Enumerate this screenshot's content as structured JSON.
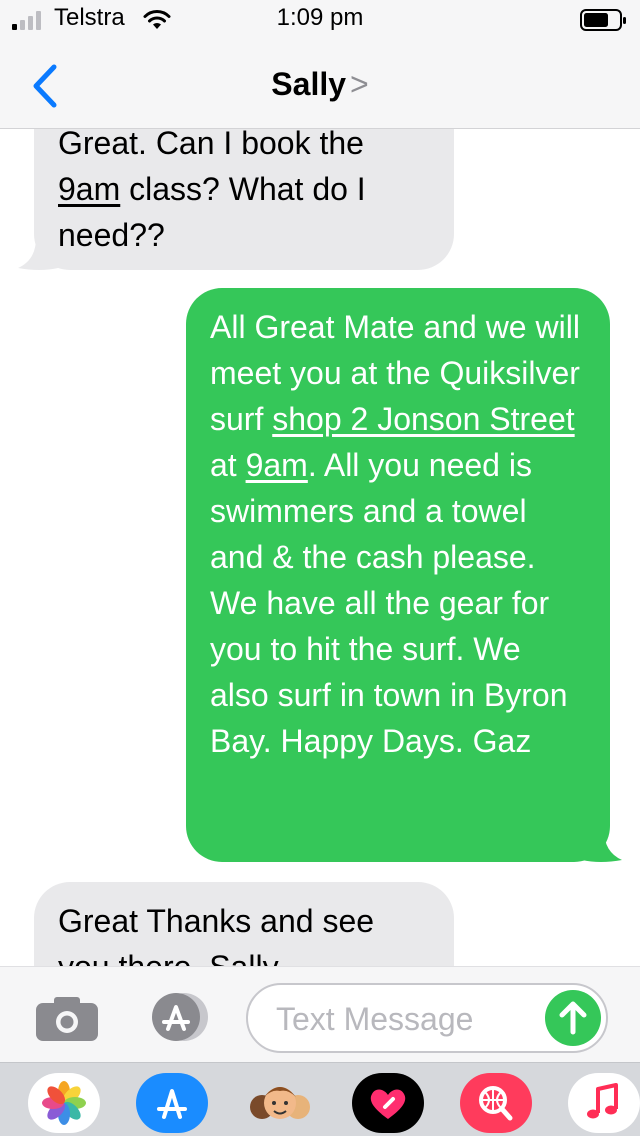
{
  "status": {
    "carrier": "Telstra",
    "time": "1:09 pm"
  },
  "nav": {
    "contact": "Sally",
    "chevron": ">"
  },
  "messages": [
    {
      "direction": "incoming",
      "parts": [
        "Great. Can I book the ",
        "9am",
        " class? What do I need??"
      ]
    },
    {
      "direction": "outgoing",
      "parts": [
        "All Great Mate and we will meet you at the Quiksilver surf ",
        "shop 2 Jonson Street",
        " at ",
        "9am",
        ". All you need is swimmers and a towel and & the cash please. We have all the gear for you to hit the surf. We also surf in town in Byron Bay. Happy Days. Gaz"
      ]
    },
    {
      "direction": "incoming",
      "parts": [
        "Great Thanks and see you there. Sally"
      ]
    }
  ],
  "composer": {
    "placeholder": "Text Message",
    "value": ""
  },
  "colors": {
    "outgoing": "#35c759",
    "incoming": "#e9e9eb",
    "accent": "#0a7aff"
  },
  "icons": {
    "back": "chevron-left-icon",
    "camera": "camera-icon",
    "apps": "app-store-icon",
    "send": "send-arrow-icon"
  },
  "drawer_apps": [
    "photos-icon",
    "app-store-icon",
    "memoji-icon",
    "digital-touch-icon",
    "images-search-icon",
    "music-icon"
  ]
}
